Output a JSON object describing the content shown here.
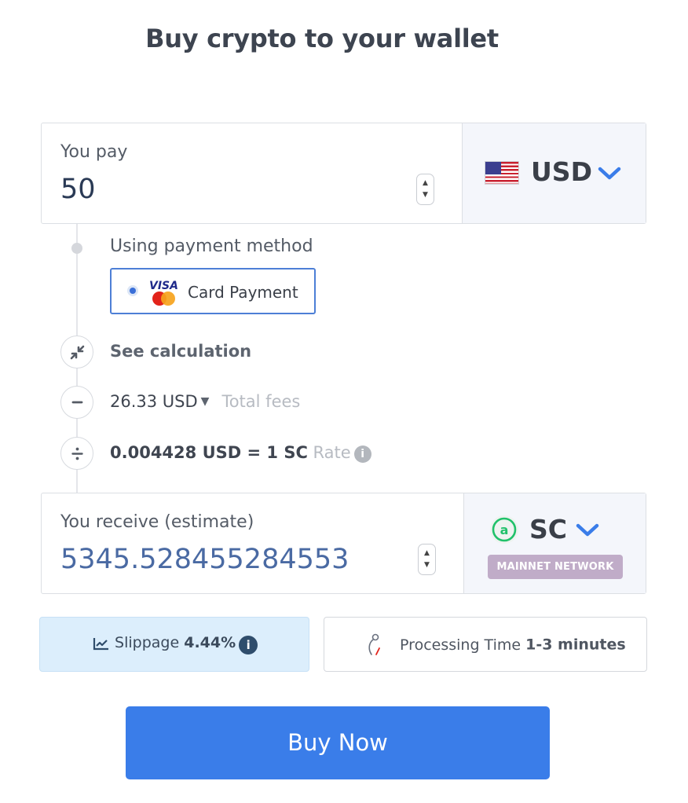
{
  "page": {
    "title": "Buy crypto to your wallet"
  },
  "pay": {
    "label": "You pay",
    "amount": "50",
    "currency": {
      "code": "USD",
      "icon": "us-flag-icon"
    }
  },
  "payment_method": {
    "label": "Using payment method",
    "selected": {
      "label": "Card Payment",
      "icon": "visa-mastercard-icon"
    }
  },
  "calculation": {
    "toggle_label": "See calculation",
    "fees": {
      "value": "26.33 USD",
      "label": "Total fees"
    },
    "rate": {
      "value": "0.004428 USD = 1 SC",
      "label": "Rate"
    }
  },
  "receive": {
    "label": "You receive (estimate)",
    "amount": "5345.528455284553",
    "currency": {
      "code": "SC",
      "icon": "siacoin-logo-icon",
      "network": "MAINNET NETWORK"
    }
  },
  "slippage": {
    "label": "Slippage",
    "value": "4.44%"
  },
  "processing": {
    "label": "Processing Time",
    "value": "1-3 minutes"
  },
  "actions": {
    "buy_label": "Buy Now"
  },
  "colors": {
    "primary": "#3a7de9",
    "selected_border": "#4d7fd6",
    "network_badge": "#c0acc8",
    "slippage_bg": "#dceefc",
    "amount_receive": "#4a6aa3"
  }
}
